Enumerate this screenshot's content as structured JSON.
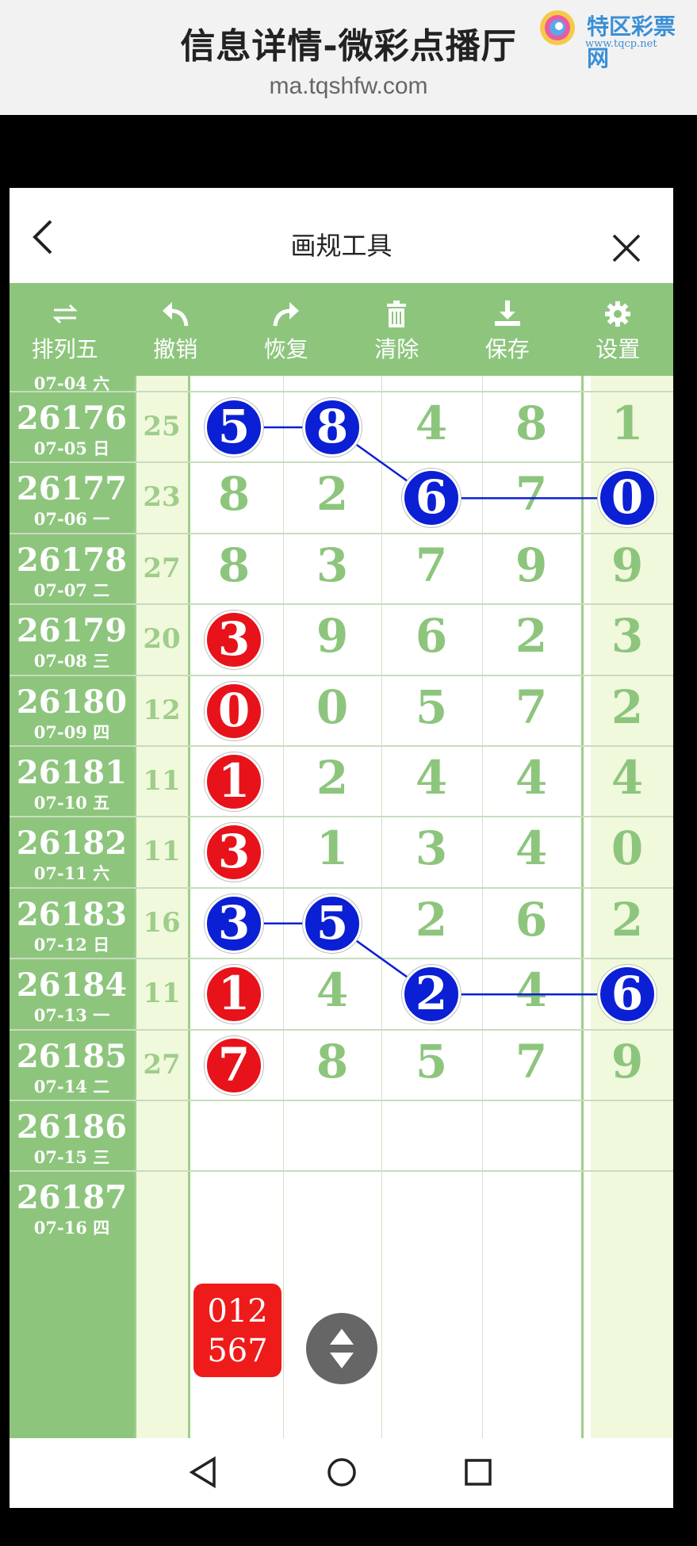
{
  "banner": {
    "title": "信息详情-微彩点播厅",
    "url": "ma.tqshfw.com",
    "brand_name": "特区彩票网",
    "brand_site": "www.tqcp.net"
  },
  "topbar": {
    "title": "画规工具",
    "back_icon": "chevron-left-icon",
    "close_icon": "close-icon"
  },
  "toolbar": [
    {
      "label": "排列五",
      "icon": "swap-arrows-icon"
    },
    {
      "label": "撤销",
      "icon": "undo-icon"
    },
    {
      "label": "恢复",
      "icon": "redo-icon"
    },
    {
      "label": "清除",
      "icon": "trash-icon"
    },
    {
      "label": "保存",
      "icon": "download-icon"
    },
    {
      "label": "设置",
      "icon": "gear-icon"
    }
  ],
  "partial_row": {
    "date": "07-04 六"
  },
  "rows": [
    {
      "period": "26176",
      "date": "07-05 日",
      "sum": "25",
      "nums": [
        "5",
        "8",
        "4",
        "8",
        "1"
      ]
    },
    {
      "period": "26177",
      "date": "07-06 一",
      "sum": "23",
      "nums": [
        "8",
        "2",
        "6",
        "7",
        "0"
      ]
    },
    {
      "period": "26178",
      "date": "07-07 二",
      "sum": "27",
      "nums": [
        "8",
        "3",
        "7",
        "9",
        "9"
      ]
    },
    {
      "period": "26179",
      "date": "07-08 三",
      "sum": "20",
      "nums": [
        "3",
        "9",
        "6",
        "2",
        "3"
      ]
    },
    {
      "period": "26180",
      "date": "07-09 四",
      "sum": "12",
      "nums": [
        "0",
        "0",
        "5",
        "7",
        "2"
      ]
    },
    {
      "period": "26181",
      "date": "07-10 五",
      "sum": "11",
      "nums": [
        "1",
        "2",
        "4",
        "4",
        "4"
      ]
    },
    {
      "period": "26182",
      "date": "07-11 六",
      "sum": "11",
      "nums": [
        "3",
        "1",
        "3",
        "4",
        "0"
      ]
    },
    {
      "period": "26183",
      "date": "07-12 日",
      "sum": "16",
      "nums": [
        "3",
        "5",
        "2",
        "6",
        "2"
      ]
    },
    {
      "period": "26184",
      "date": "07-13 一",
      "sum": "11",
      "nums": [
        "1",
        "4",
        "2",
        "4",
        "6"
      ]
    },
    {
      "period": "26185",
      "date": "07-14 二",
      "sum": "27",
      "nums": [
        "7",
        "8",
        "5",
        "7",
        "9"
      ]
    },
    {
      "period": "26186",
      "date": "07-15 三",
      "sum": "",
      "nums": [
        "",
        "",
        "",
        "",
        ""
      ]
    },
    {
      "period": "26187",
      "date": "07-16 四",
      "sum": "",
      "nums": [
        "",
        "",
        "",
        "",
        ""
      ]
    }
  ],
  "marks": [
    {
      "row": 0,
      "col": 0,
      "color": "blue"
    },
    {
      "row": 0,
      "col": 1,
      "color": "blue"
    },
    {
      "row": 1,
      "col": 2,
      "color": "blue"
    },
    {
      "row": 1,
      "col": 4,
      "color": "blue"
    },
    {
      "row": 3,
      "col": 0,
      "color": "red"
    },
    {
      "row": 4,
      "col": 0,
      "color": "red"
    },
    {
      "row": 5,
      "col": 0,
      "color": "red"
    },
    {
      "row": 6,
      "col": 0,
      "color": "red"
    },
    {
      "row": 7,
      "col": 0,
      "color": "blue"
    },
    {
      "row": 7,
      "col": 1,
      "color": "blue"
    },
    {
      "row": 8,
      "col": 2,
      "color": "blue"
    },
    {
      "row": 8,
      "col": 4,
      "color": "blue"
    },
    {
      "row": 8,
      "col": 0,
      "color": "red"
    },
    {
      "row": 9,
      "col": 0,
      "color": "red"
    }
  ],
  "prediction": {
    "line1": "012",
    "line2": "567"
  },
  "fab_icon": "scroll-toggle-icon",
  "navbar": [
    {
      "icon": "back-triangle-icon"
    },
    {
      "icon": "home-circle-icon"
    },
    {
      "icon": "recents-square-icon"
    }
  ],
  "colors": {
    "accent_green": "#8dc57d",
    "light_green": "#f0f9dc",
    "ball_blue": "#0b1fd4",
    "ball_red": "#e8121a"
  }
}
